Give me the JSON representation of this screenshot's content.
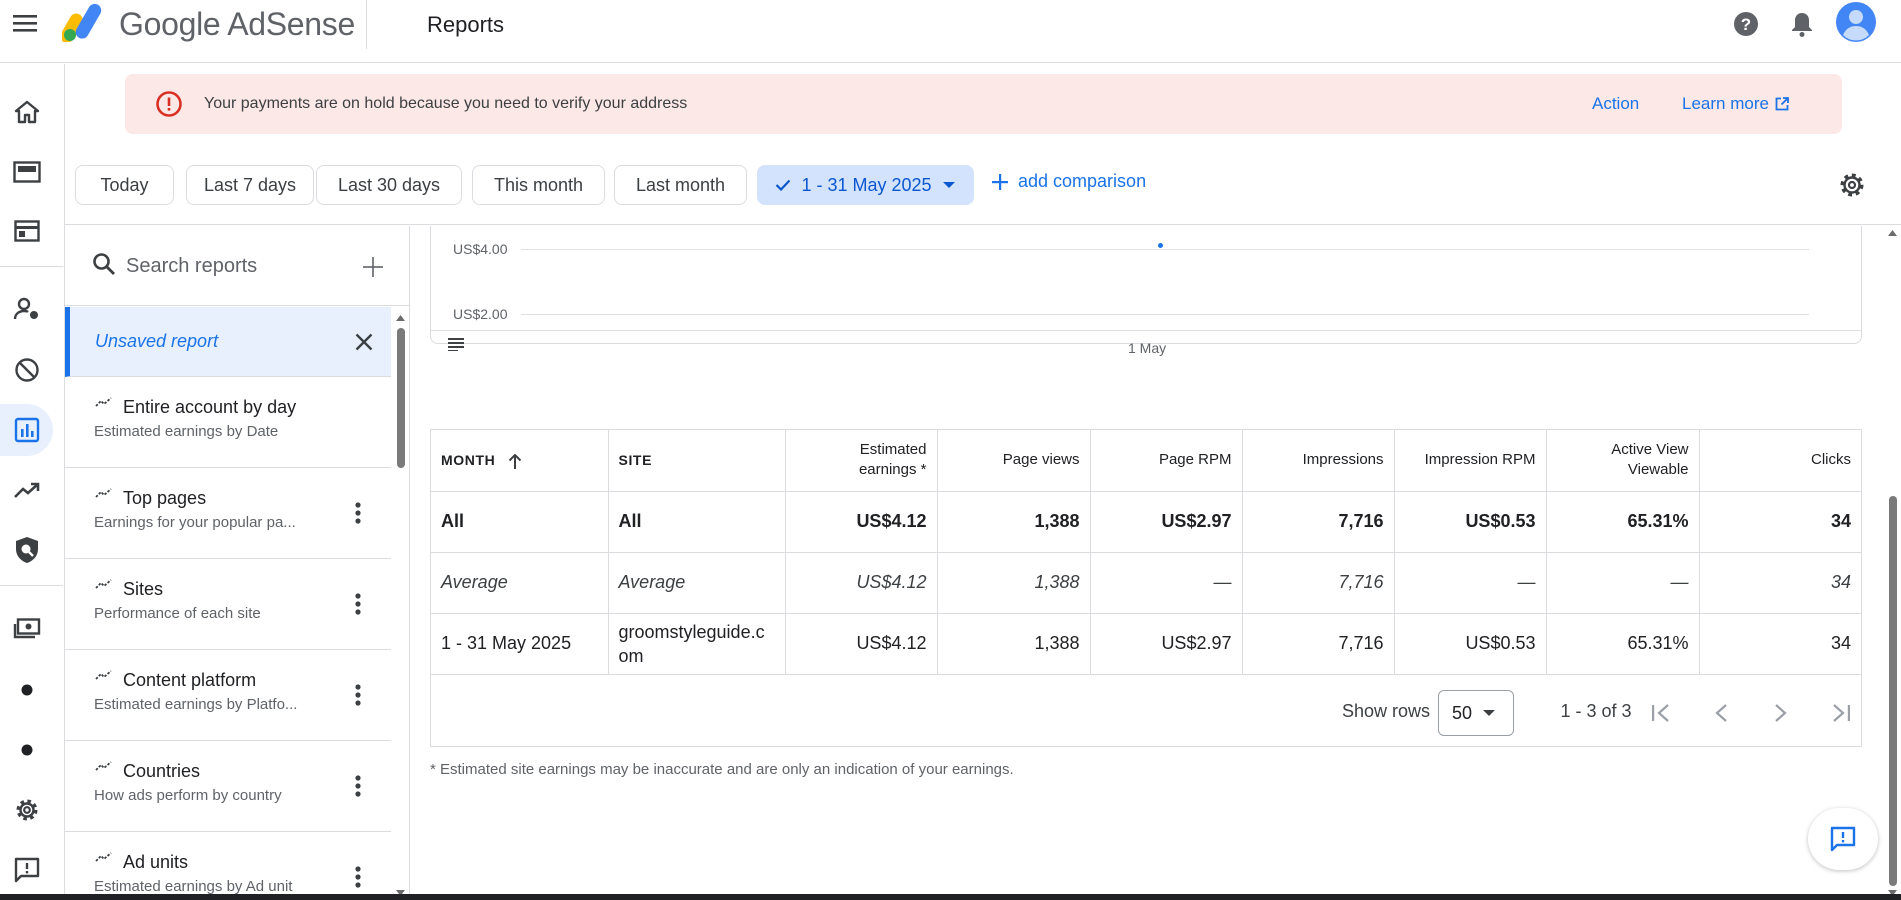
{
  "header": {
    "brand": "Google AdSense",
    "page_title": "Reports"
  },
  "banner": {
    "message": "Your payments are on hold because you need to verify your address",
    "action_label": "Action",
    "learn_more_label": "Learn more"
  },
  "date_ranges": {
    "today": "Today",
    "last7": "Last 7 days",
    "last30": "Last 30 days",
    "this_month": "This month",
    "last_month": "Last month",
    "selected": "1 - 31 May 2025",
    "add_comparison": "add comparison"
  },
  "sidepanel": {
    "search_placeholder": "Search reports",
    "unsaved_label": "Unsaved report",
    "reports": [
      {
        "title": "Entire account by day",
        "subtitle": "Estimated earnings by Date"
      },
      {
        "title": "Top pages",
        "subtitle": "Earnings for your popular pa..."
      },
      {
        "title": "Sites",
        "subtitle": "Performance of each site"
      },
      {
        "title": "Content platform",
        "subtitle": "Estimated earnings by Platfo..."
      },
      {
        "title": "Countries",
        "subtitle": "How ads perform by country"
      },
      {
        "title": "Ad units",
        "subtitle": "Estimated earnings by Ad unit"
      }
    ]
  },
  "chart": {
    "y_labels": [
      "US$4.00",
      "US$2.00"
    ],
    "x_label": "1 May",
    "series_color": "#1a73e8"
  },
  "chart_data": {
    "type": "line",
    "x": [
      "1 May"
    ],
    "series": [
      {
        "values": [
          4.12
        ]
      }
    ],
    "y_ticks": [
      "US$4.00",
      "US$2.00"
    ]
  },
  "table": {
    "headers": {
      "month": "MONTH",
      "site": "SITE",
      "est_earnings_1": "Estimated",
      "est_earnings_2": "earnings *",
      "page_views": "Page views",
      "page_rpm": "Page RPM",
      "impressions": "Impressions",
      "impression_rpm": "Impression RPM",
      "active_view_1": "Active View",
      "active_view_2": "Viewable",
      "clicks": "Clicks"
    },
    "rows": [
      {
        "month": "All",
        "site": "All",
        "earnings": "US$4.12",
        "page_views": "1,388",
        "page_rpm": "US$2.97",
        "impressions": "7,716",
        "imp_rpm": "US$0.53",
        "viewable": "65.31%",
        "clicks": "34"
      },
      {
        "month": "Average",
        "site": "Average",
        "earnings": "US$4.12",
        "page_views": "1,388",
        "page_rpm": "—",
        "impressions": "7,716",
        "imp_rpm": "—",
        "viewable": "—",
        "clicks": "34"
      },
      {
        "month": "1 - 31 May 2025",
        "site": "groomstyleguide.com",
        "earnings": "US$4.12",
        "page_views": "1,388",
        "page_rpm": "US$2.97",
        "impressions": "7,716",
        "imp_rpm": "US$0.53",
        "viewable": "65.31%",
        "clicks": "34"
      }
    ],
    "show_rows_label": "Show rows",
    "rows_per_page": "50",
    "range_text": "1 - 3 of 3"
  },
  "footnote": "* Estimated site earnings may be inaccurate and are only an indication of your earnings."
}
